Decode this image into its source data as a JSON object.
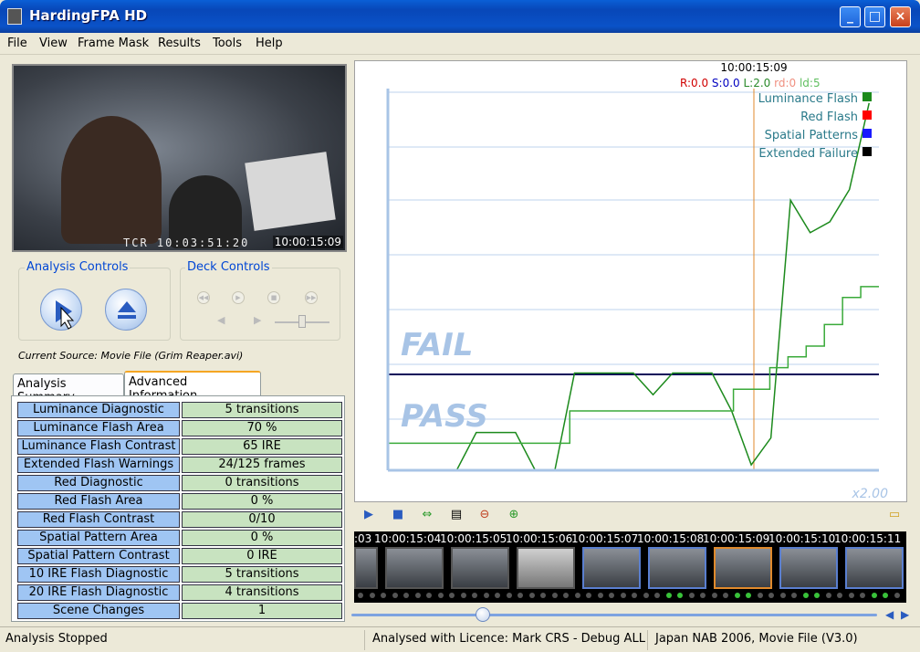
{
  "window": {
    "title": "HardingFPA HD",
    "buttons": {
      "minimize": "_",
      "maximize": "□",
      "close": "×"
    }
  },
  "menu": [
    "File",
    "View",
    "Frame Mask",
    "Results",
    "Tools",
    "Help"
  ],
  "video": {
    "overlay_text": "TCR 10:03:51:20",
    "timecode": "10:00:15:09"
  },
  "analysis_controls": {
    "label": "Analysis Controls",
    "buttons": [
      "analyse-icon",
      "eject-icon"
    ]
  },
  "deck_controls": {
    "label": "Deck Controls",
    "buttons": [
      "rewind-icon",
      "play-icon",
      "stop-icon",
      "fast-forward-icon",
      "step-back-icon",
      "step-forward-icon"
    ]
  },
  "current_source": "Current Source: Movie File (Grim Reaper.avi)",
  "tabs": [
    {
      "label": "Analysis Summary",
      "active": false
    },
    {
      "label": "Advanced Information",
      "active": true
    }
  ],
  "info_table": [
    {
      "key": "Luminance Diagnostic",
      "value": "5 transitions"
    },
    {
      "key": "Luminance Flash Area",
      "value": "70 %"
    },
    {
      "key": "Luminance Flash Contrast",
      "value": "65 IRE"
    },
    {
      "key": "Extended Flash Warnings",
      "value": "24/125 frames"
    },
    {
      "key": "Red Diagnostic",
      "value": "0 transitions"
    },
    {
      "key": "Red Flash Area",
      "value": "0 %"
    },
    {
      "key": "Red Flash Contrast",
      "value": "0/10"
    },
    {
      "key": "Spatial Pattern Area",
      "value": "0 %"
    },
    {
      "key": "Spatial Pattern Contrast",
      "value": "0 IRE"
    },
    {
      "key": "10 IRE Flash Diagnostic",
      "value": "5 transitions"
    },
    {
      "key": "20 IRE Flash Diagnostic",
      "value": "4 transitions"
    },
    {
      "key": "Scene Changes",
      "value": "1"
    }
  ],
  "chart": {
    "timecode": "10:00:15:09",
    "readout": [
      {
        "text": "R:0.0",
        "color": "#d00000"
      },
      {
        "text": "S:0.0",
        "color": "#0000c0"
      },
      {
        "text": "L:2.0",
        "color": "#2a8a2a"
      },
      {
        "text": "rd:0",
        "color": "#f09080"
      },
      {
        "text": "ld:5",
        "color": "#5fbf5f"
      }
    ],
    "fail_label": "FAIL",
    "pass_label": "PASS",
    "zoom": "x2.00",
    "legend": [
      {
        "label": "Luminance Flash",
        "color": "#1c8a1c"
      },
      {
        "label": "Red Flash",
        "color": "#ff0000"
      },
      {
        "label": "Spatial Patterns",
        "color": "#1a1aff"
      },
      {
        "label": "Extended Failure",
        "color": "#000000"
      }
    ]
  },
  "chart_data": {
    "type": "line",
    "title": "",
    "xlabel": "",
    "ylabel": "",
    "threshold": 1.0,
    "series": [
      {
        "name": "Luminance Flash",
        "values": [
          0,
          0,
          0,
          0,
          0.35,
          0.35,
          0.35,
          0,
          0,
          0.9,
          0.9,
          0.9,
          0.9,
          0.7,
          0.9,
          0.9,
          0.9,
          0.55,
          0.05,
          0.3,
          2.5,
          2.2,
          2.3,
          2.6,
          3.4
        ]
      },
      {
        "name": "Extended Failure",
        "values": [
          0.25,
          0.25,
          0.25,
          0.25,
          0.25,
          0.25,
          0.25,
          0.25,
          0.25,
          0.25,
          0.55,
          0.55,
          0.55,
          0.55,
          0.55,
          0.55,
          0.55,
          0.55,
          0.55,
          0.75,
          0.75,
          0.95,
          1.05,
          1.15,
          1.35,
          1.6,
          1.7
        ]
      }
    ]
  },
  "toolbar_icons": [
    "play-icon",
    "stop-icon",
    "sync-icon",
    "filmstrip-icon",
    "zoom-out-icon",
    "zoom-in-icon",
    "folder-icon"
  ],
  "filmstrip": {
    "timecodes": [
      ":03",
      "10:00:15:04",
      "10:00:15:05",
      "10:00:15:06",
      "10:00:15:07",
      "10:00:15:08",
      "10:00:15:09",
      "10:00:15:10",
      "10:00:15:11"
    ]
  },
  "position_slider": {
    "value": 0.25
  },
  "status": [
    "Analysis Stopped",
    "Analysed with Licence: Mark CRS - Debug ALL",
    "Japan NAB 2006, Movie File (V3.0)"
  ]
}
